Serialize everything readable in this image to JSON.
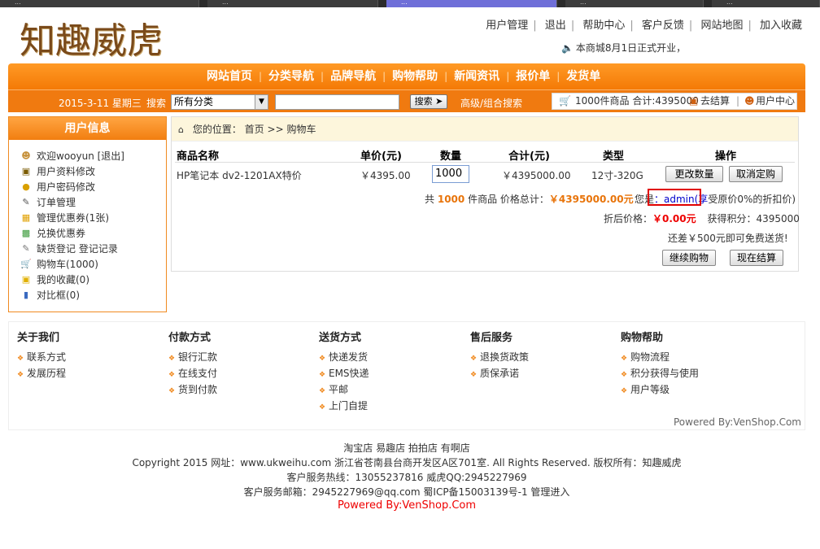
{
  "browser": {
    "tabs": [
      {
        "label": "...",
        "active": false
      },
      {
        "label": "...",
        "active": false
      },
      {
        "label": "...",
        "active": true
      },
      {
        "label": "...",
        "active": false
      },
      {
        "label": "...",
        "active": false
      }
    ]
  },
  "header": {
    "logo_text": "知趣威虎",
    "links": [
      "用户管理",
      "退出",
      "帮助中心",
      "客户反馈",
      "网站地图",
      "加入收藏"
    ],
    "notice": "本商城8月1日正式开业，"
  },
  "nav": {
    "items": [
      "网站首页",
      "分类导航",
      "品牌导航",
      "购物帮助",
      "新闻资讯",
      "报价单",
      "发货单"
    ]
  },
  "searchbar": {
    "date": "2015-3-11 星期三",
    "search_label": "搜索",
    "category_selected": "所有分类",
    "search_button": "搜索",
    "advanced": "高级/组合搜索",
    "cart_summary": "1000件商品 合计:4395000",
    "checkout": "去结算",
    "user_center": "用户中心"
  },
  "sidebar": {
    "title": "用户信息",
    "items": [
      {
        "label": "欢迎wooyun [退出]",
        "icon": "user-icon"
      },
      {
        "label": "用户资料修改",
        "icon": "profile-icon"
      },
      {
        "label": "用户密码修改",
        "icon": "lock-icon"
      },
      {
        "label": "订单管理",
        "icon": "order-icon"
      },
      {
        "label": "管理优惠券(1张)",
        "icon": "coupon-icon"
      },
      {
        "label": "兑换优惠券",
        "icon": "exchange-icon"
      },
      {
        "label": "缺货登记 登记记录",
        "icon": "register-icon"
      },
      {
        "label": "购物车(1000)",
        "icon": "cart-icon"
      },
      {
        "label": "我的收藏(0)",
        "icon": "folder-icon"
      },
      {
        "label": "对比框(0)",
        "icon": "chart-icon"
      }
    ]
  },
  "cart": {
    "breadcrumb_prefix": "您的位置：",
    "breadcrumb_home": "首页",
    "breadcrumb_sep": ">>",
    "breadcrumb_current": "购物车",
    "headers": [
      "商品名称",
      "单价(元)",
      "数量",
      "合计(元)",
      "类型",
      "操作"
    ],
    "row": {
      "name": "HP笔记本 dv2-1201AX特价",
      "price": "￥4395.00",
      "quantity": "1000",
      "total": "￥4395000.00",
      "type": "12寸-320G",
      "update_btn": "更改数量",
      "cancel_btn": "取消定购"
    },
    "summary_prefix": "共",
    "summary_count": "1000",
    "summary_mid": "件商品 价格总计：",
    "summary_total": "￥4395000.00元",
    "you_are_prefix": "您是",
    "admin_text": "：admin(享",
    "discount_suffix": "受原价0%的折扣价)",
    "discount_label": "折后价格：",
    "discount_price": "￥0.00元",
    "points_label": "获得积分：",
    "points_value": "4395000",
    "free_ship": "还差￥500元即可免费送货!",
    "continue_btn": "继续购物",
    "checkout_btn": "现在结算"
  },
  "footer": {
    "columns": [
      {
        "title": "关于我们",
        "items": [
          "联系方式",
          "发展历程"
        ]
      },
      {
        "title": "付款方式",
        "items": [
          "银行汇款",
          "在线支付",
          "货到付款"
        ]
      },
      {
        "title": "送货方式",
        "items": [
          "快递发货",
          "EMS快递",
          "平邮",
          "上门自提"
        ]
      },
      {
        "title": "售后服务",
        "items": [
          "退换货政策",
          "质保承诺"
        ]
      },
      {
        "title": "购物帮助",
        "items": [
          "购物流程",
          "积分获得与使用",
          "用户等级"
        ]
      }
    ],
    "powered_right": "Powered By:VenShop.Com"
  },
  "bottom": {
    "links_line": "淘宝店 易趣店 拍拍店 有啊店",
    "copyright": "Copyright 2015 网址：www.ukweihu.com 浙江省苍南县台商开发区A区701室. All Rights Reserved. 版权所有：知趣威虎",
    "hotline": "客户服务热线：13055237816 威虎QQ:2945227969",
    "email": "客户服务邮箱：2945227969@qq.com 蜀ICP备15003139号-1 管理进入",
    "powered": "Powered By:VenShop.Com"
  },
  "colors": {
    "brand_orange": "#f47a06",
    "price_orange": "#e8740a",
    "highlight_red": "#e00000"
  }
}
